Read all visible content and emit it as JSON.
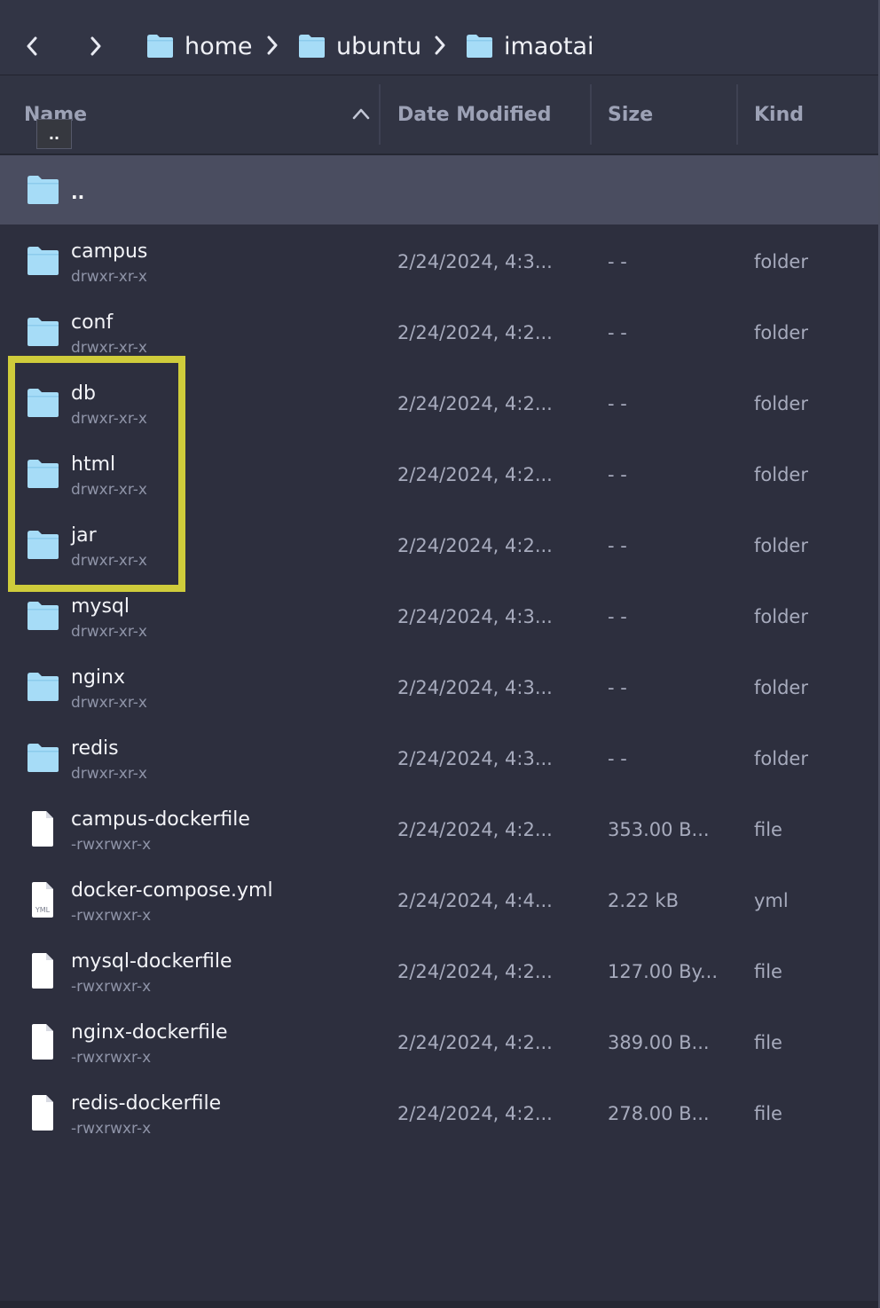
{
  "breadcrumb": {
    "items": [
      {
        "label": "home"
      },
      {
        "label": "ubuntu"
      },
      {
        "label": "imaotai"
      }
    ]
  },
  "header": {
    "name": "Name",
    "date_modified": "Date Modified",
    "size": "Size",
    "kind": "Kind",
    "tooltip": ".."
  },
  "parent_row": {
    "label": ".."
  },
  "files": [
    {
      "name": "campus",
      "perm": "drwxr-xr-x",
      "date": "2/24/2024, 4:3...",
      "size": "- -",
      "kind": "folder",
      "icon": "folder-icon"
    },
    {
      "name": "conf",
      "perm": "drwxr-xr-x",
      "date": "2/24/2024, 4:2...",
      "size": "- -",
      "kind": "folder",
      "icon": "folder-icon"
    },
    {
      "name": "db",
      "perm": "drwxr-xr-x",
      "date": "2/24/2024, 4:2...",
      "size": "- -",
      "kind": "folder",
      "icon": "folder-icon"
    },
    {
      "name": "html",
      "perm": "drwxr-xr-x",
      "date": "2/24/2024, 4:2...",
      "size": "- -",
      "kind": "folder",
      "icon": "folder-icon"
    },
    {
      "name": "jar",
      "perm": "drwxr-xr-x",
      "date": "2/24/2024, 4:2...",
      "size": "- -",
      "kind": "folder",
      "icon": "folder-icon"
    },
    {
      "name": "mysql",
      "perm": "drwxr-xr-x",
      "date": "2/24/2024, 4:3...",
      "size": "- -",
      "kind": "folder",
      "icon": "folder-icon"
    },
    {
      "name": "nginx",
      "perm": "drwxr-xr-x",
      "date": "2/24/2024, 4:3...",
      "size": "- -",
      "kind": "folder",
      "icon": "folder-icon"
    },
    {
      "name": "redis",
      "perm": "drwxr-xr-x",
      "date": "2/24/2024, 4:3...",
      "size": "- -",
      "kind": "folder",
      "icon": "folder-icon"
    },
    {
      "name": "campus-dockerfile",
      "perm": "-rwxrwxr-x",
      "date": "2/24/2024, 4:2...",
      "size": "353.00 B...",
      "kind": "file",
      "icon": "file-icon"
    },
    {
      "name": "docker-compose.yml",
      "perm": "-rwxrwxr-x",
      "date": "2/24/2024, 4:4...",
      "size": "2.22 kB",
      "kind": "yml",
      "icon": "yml-file-icon",
      "badge": "YML"
    },
    {
      "name": "mysql-dockerfile",
      "perm": "-rwxrwxr-x",
      "date": "2/24/2024, 4:2...",
      "size": "127.00 By...",
      "kind": "file",
      "icon": "file-icon"
    },
    {
      "name": "nginx-dockerfile",
      "perm": "-rwxrwxr-x",
      "date": "2/24/2024, 4:2...",
      "size": "389.00 B...",
      "kind": "file",
      "icon": "file-icon"
    },
    {
      "name": "redis-dockerfile",
      "perm": "-rwxrwxr-x",
      "date": "2/24/2024, 4:2...",
      "size": "278.00 B...",
      "kind": "file",
      "icon": "file-icon"
    }
  ],
  "colors": {
    "folder": "#a6dcf7",
    "highlight": "#cfcc3b",
    "selected_row": "#4a4d60"
  }
}
